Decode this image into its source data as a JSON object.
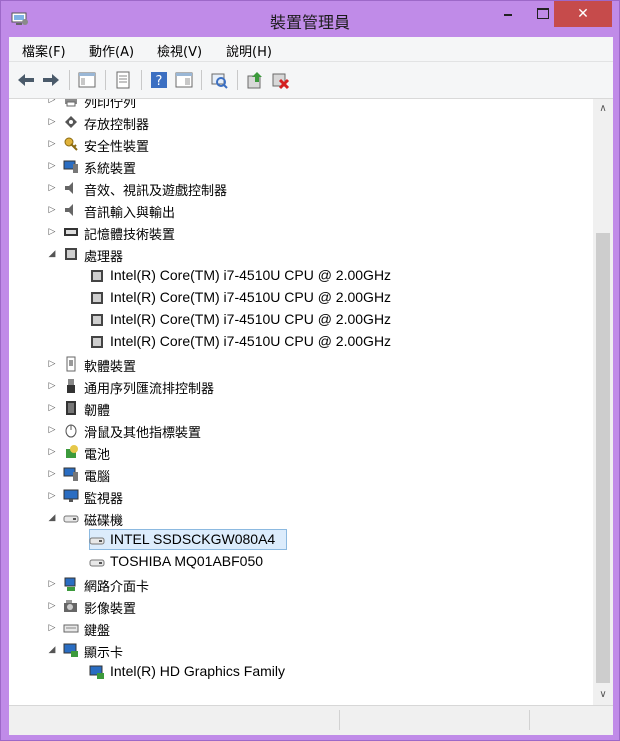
{
  "window": {
    "title": "裝置管理員",
    "controls": {
      "minimize": "–",
      "maximize": "□",
      "close": "✕"
    }
  },
  "menu": [
    {
      "label": "檔案(F)"
    },
    {
      "label": "動作(A)"
    },
    {
      "label": "檢視(V)"
    },
    {
      "label": "說明(H)"
    }
  ],
  "toolbar": [
    "back-arrow-icon",
    "forward-arrow-icon",
    "show-hide-console-tree-icon",
    "properties-icon",
    "help-icon",
    "view-icon",
    "scan-hardware-icon",
    "update-driver-icon",
    "uninstall-icon"
  ],
  "tree": {
    "nodes": [
      {
        "label": "列印佇列",
        "expander": "▷",
        "icon": "printer-icon",
        "level": 0
      },
      {
        "label": "存放控制器",
        "expander": "▷",
        "icon": "storage-controller-icon",
        "level": 0
      },
      {
        "label": "安全性裝置",
        "expander": "▷",
        "icon": "security-key-icon",
        "level": 0
      },
      {
        "label": "系統裝置",
        "expander": "▷",
        "icon": "system-device-icon",
        "level": 0
      },
      {
        "label": "音效、視訊及遊戲控制器",
        "expander": "▷",
        "icon": "speaker-icon",
        "level": 0
      },
      {
        "label": "音訊輸入與輸出",
        "expander": "▷",
        "icon": "speaker-icon",
        "level": 0
      },
      {
        "label": "記憶體技術裝置",
        "expander": "▷",
        "icon": "memory-icon",
        "level": 0
      },
      {
        "label": "處理器",
        "expander": "◢",
        "icon": "processor-icon",
        "level": 0
      },
      {
        "label": "Intel(R) Core(TM) i7-4510U CPU @ 2.00GHz",
        "icon": "processor-icon",
        "level": 1
      },
      {
        "label": "Intel(R) Core(TM) i7-4510U CPU @ 2.00GHz",
        "icon": "processor-icon",
        "level": 1
      },
      {
        "label": "Intel(R) Core(TM) i7-4510U CPU @ 2.00GHz",
        "icon": "processor-icon",
        "level": 1
      },
      {
        "label": "Intel(R) Core(TM) i7-4510U CPU @ 2.00GHz",
        "icon": "processor-icon",
        "level": 1
      },
      {
        "label": "軟體裝置",
        "expander": "▷",
        "icon": "software-device-icon",
        "level": 0
      },
      {
        "label": "通用序列匯流排控制器",
        "expander": "▷",
        "icon": "usb-icon",
        "level": 0
      },
      {
        "label": "韌體",
        "expander": "▷",
        "icon": "firmware-icon",
        "level": 0
      },
      {
        "label": "滑鼠及其他指標裝置",
        "expander": "▷",
        "icon": "mouse-icon",
        "level": 0
      },
      {
        "label": "電池",
        "expander": "▷",
        "icon": "battery-icon",
        "level": 0
      },
      {
        "label": "電腦",
        "expander": "▷",
        "icon": "computer-icon",
        "level": 0
      },
      {
        "label": "監視器",
        "expander": "▷",
        "icon": "monitor-icon",
        "level": 0
      },
      {
        "label": "磁碟機",
        "expander": "◢",
        "icon": "disk-drive-icon",
        "level": 0
      },
      {
        "label": "INTEL SSDSCKGW080A4",
        "icon": "disk-drive-icon",
        "level": 1,
        "selected": true
      },
      {
        "label": "TOSHIBA MQ01ABF050",
        "icon": "disk-drive-icon",
        "level": 1
      },
      {
        "label": "網路介面卡",
        "expander": "▷",
        "icon": "network-adapter-icon",
        "level": 0
      },
      {
        "label": "影像裝置",
        "expander": "▷",
        "icon": "imaging-device-icon",
        "level": 0
      },
      {
        "label": "鍵盤",
        "expander": "▷",
        "icon": "keyboard-icon",
        "level": 0
      },
      {
        "label": "顯示卡",
        "expander": "◢",
        "icon": "display-adapter-icon",
        "level": 0
      },
      {
        "label": "Intel(R) HD Graphics Family",
        "icon": "display-adapter-icon",
        "level": 1
      }
    ]
  },
  "scrollbar": {
    "up": "∧",
    "down": "∨"
  },
  "colors": {
    "titlebar": "#c08be8",
    "close": "#c64b4b",
    "selection_bg": "#dcecfc",
    "selection_border": "#8cb9e0"
  }
}
